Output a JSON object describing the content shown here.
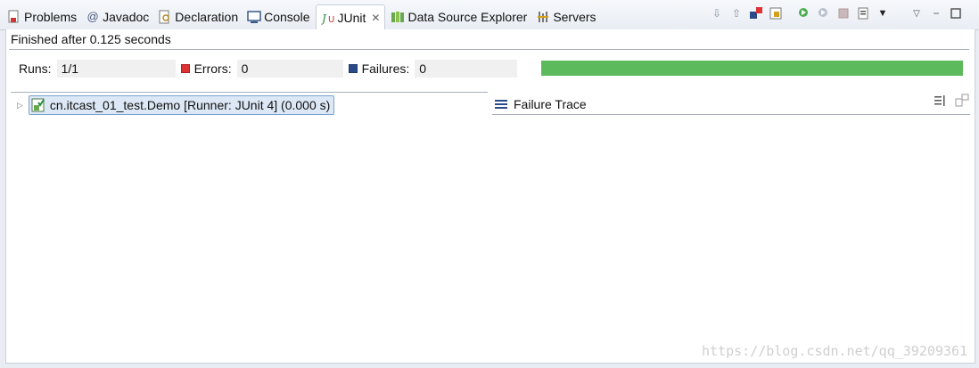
{
  "tabs": [
    {
      "label": "Problems",
      "icon": "problems-icon"
    },
    {
      "label": "Javadoc",
      "icon": "at-icon"
    },
    {
      "label": "Declaration",
      "icon": "declaration-icon"
    },
    {
      "label": "Console",
      "icon": "console-icon"
    },
    {
      "label": "JUnit",
      "icon": "junit-icon",
      "active": true,
      "close": "✕"
    },
    {
      "label": "Data Source Explorer",
      "icon": "database-icon"
    },
    {
      "label": "Servers",
      "icon": "servers-icon"
    }
  ],
  "status": "Finished after 0.125 seconds",
  "counters": {
    "runs_label": "Runs:",
    "runs_value": "1/1",
    "errors_label": "Errors:",
    "errors_value": "0",
    "failures_label": "Failures:",
    "failures_value": "0"
  },
  "progress": {
    "fraction": 1.0,
    "color": "#5cba5c"
  },
  "tree": {
    "item": "cn.itcast_01_test.Demo [Runner: JUnit 4] (0.000 s)"
  },
  "failure_trace": {
    "title": "Failure Trace"
  },
  "watermark": "https://blog.csdn.net/qq_39209361"
}
